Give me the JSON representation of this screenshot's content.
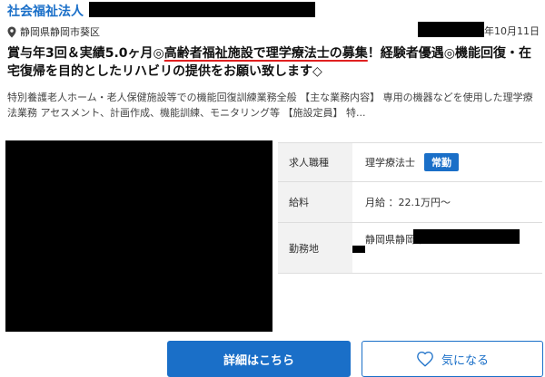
{
  "header": {
    "organization": "社会福祉法人",
    "date_suffix": "年10月11日",
    "location": "静岡県静岡市葵区"
  },
  "job": {
    "title_before": "賞与年3回＆実績5.0ヶ月◎",
    "title_highlight": "高齢者福祉施設で理学療法士の募集",
    "title_after": "！経験者優遇◎機能回復・在宅復帰を目的としたリハビリの提供をお願い致します◇",
    "description": "特別養護老人ホーム・老人保健施設等での機能回復訓練業務全般 【主な業務内容】 専用の機器などを使用した理学療法業務 アセスメント、計画作成、機能訓練、モニタリング等 【施設定員】 特..."
  },
  "details": {
    "job_type_label": "求人職種",
    "job_type_value": "理学療法士",
    "employment_badge": "常勤",
    "salary_label": "給料",
    "salary_value": "月給 ：22.1万円〜",
    "workplace_label": "勤務地",
    "workplace_value": "静岡県静岡市"
  },
  "actions": {
    "detail_button": "詳細はこちら",
    "favorite_button": "気になる"
  },
  "icons": {
    "location": "map-pin-icon",
    "favorite": "heart-icon"
  },
  "colors": {
    "accent": "#1a6fc8",
    "highlight_underline": "#e02020",
    "label_bg": "#f2f2f2"
  }
}
